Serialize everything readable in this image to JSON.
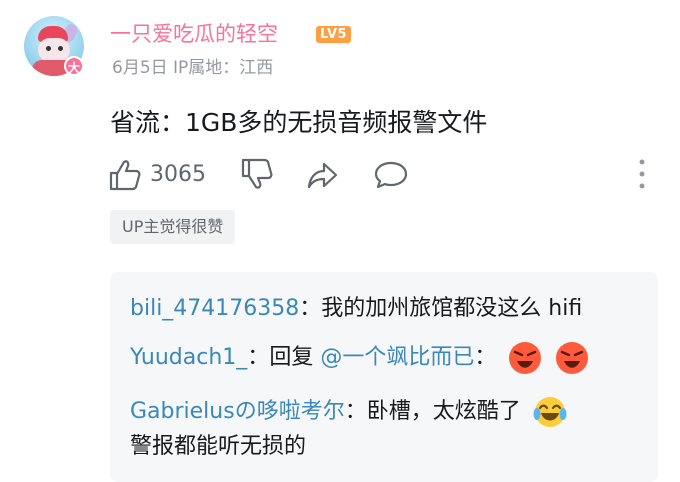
{
  "comment": {
    "username": "一只爱吃瓜的轻空",
    "level_badge": "LV5",
    "avatar_badge": "大",
    "meta": "6月5日 IP属地：江西",
    "text": "省流：1GB多的无损音频报警文件",
    "like_count": "3065",
    "up_tag": "UP主觉得很赞"
  },
  "icons": {
    "like": "thumbs-up-icon",
    "dislike": "thumbs-down-icon",
    "share": "share-icon",
    "reply": "reply-icon",
    "more": "more-vertical-icon"
  },
  "replies": [
    {
      "user": "bili_474176358",
      "sep": "：",
      "text": "我的加州旅馆都没这么 hifi"
    },
    {
      "user": "Yuudach1_",
      "sep": "：",
      "prefix": "回复 ",
      "mention": "@一个飒比而已",
      "mention_sep": "：",
      "emojis": [
        "angry-emoji",
        "angry-emoji"
      ]
    },
    {
      "user": "Gabrielusの哆啦考尔",
      "sep": "：",
      "text": "卧槽，太炫酷了",
      "emojis": [
        "tears-of-joy-emoji"
      ],
      "text_line2": "警报都能听无损的"
    }
  ],
  "colors": {
    "username": "#fb7299",
    "reply_user": "#3a88b8",
    "meta": "#9499a0",
    "level_badge": "#ff9f43"
  }
}
